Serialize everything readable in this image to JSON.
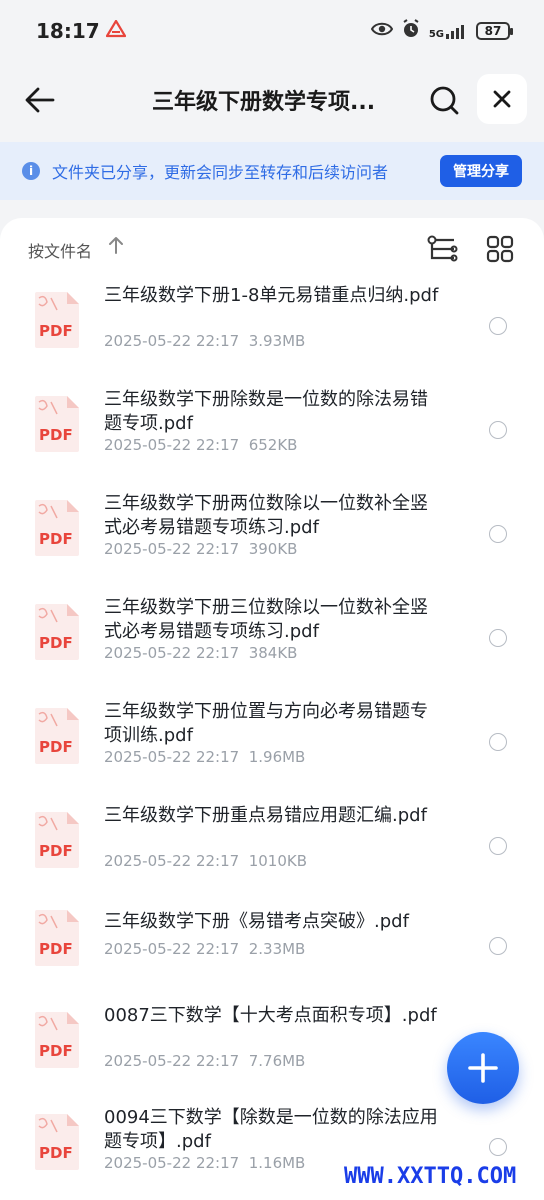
{
  "status": {
    "time": "18:17",
    "network": "5G",
    "battery": "87"
  },
  "header": {
    "title": "三年级下册数学专项..."
  },
  "banner": {
    "text": "文件夹已分享，更新会同步至转存和后续访问者",
    "manage_label": "管理分享"
  },
  "sort": {
    "label": "按文件名"
  },
  "files": [
    {
      "name": "三年级数学下册1-8单元易错重点归纳.pdf",
      "date": "2025-05-22 22:17",
      "size": "3.93MB"
    },
    {
      "name": "三年级数学下册除数是一位数的除法易错题专项.pdf",
      "date": "2025-05-22 22:17",
      "size": "652KB"
    },
    {
      "name": "三年级数学下册两位数除以一位数补全竖式必考易错题专项练习.pdf",
      "date": "2025-05-22 22:17",
      "size": "390KB"
    },
    {
      "name": "三年级数学下册三位数除以一位数补全竖式必考易错题专项练习.pdf",
      "date": "2025-05-22 22:17",
      "size": "384KB"
    },
    {
      "name": "三年级数学下册位置与方向必考易错题专项训练.pdf",
      "date": "2025-05-22 22:17",
      "size": "1.96MB"
    },
    {
      "name": "三年级数学下册重点易错应用题汇编.pdf",
      "date": "2025-05-22 22:17",
      "size": "1010KB"
    },
    {
      "name": "三年级数学下册《易错考点突破》.pdf",
      "date": "2025-05-22 22:17",
      "size": "2.33MB"
    },
    {
      "name": "0087三下数学【十大考点面积专项】.pdf",
      "date": "2025-05-22 22:17",
      "size": "7.76MB"
    },
    {
      "name": "0094三下数学【除数是一位数的除法应用题专项】.pdf",
      "date": "2025-05-22 22:17",
      "size": "1.16MB"
    }
  ],
  "pdf_label": "PDF",
  "watermark": "WWW.XXTTQ.COM",
  "colors": {
    "accent": "#1f5fe6",
    "banner_bg": "#e6eefb",
    "pdf_red": "#e8453c"
  }
}
